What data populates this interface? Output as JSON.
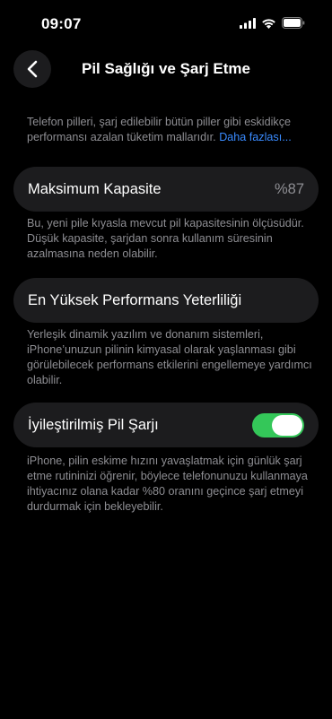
{
  "status_bar": {
    "time": "09:07"
  },
  "nav": {
    "title": "Pil Sağlığı ve Şarj Etme"
  },
  "intro": {
    "text": "Telefon pilleri, şarj edilebilir bütün piller gibi eskidikçe performansı azalan tüketim mallarıdır.",
    "link": "Daha fazlası..."
  },
  "max_capacity": {
    "label": "Maksimum Kapasite",
    "value": "%87",
    "footnote": "Bu, yeni pile kıyasla mevcut pil kapasitesinin ölçüsüdür. Düşük kapasite, şarjdan sonra kullanım süresinin azalmasına neden olabilir."
  },
  "peak_performance": {
    "label": "En Yüksek Performans Yeterliliği",
    "footnote": "Yerleşik dinamik yazılım ve donanım sistemleri, iPhone’unuzun pilinin kimyasal olarak yaşlanması gibi görülebilecek performans etkilerini engellemeye yardımcı olabilir."
  },
  "optimized_charging": {
    "label": "İyileştirilmiş Pil Şarjı",
    "enabled": true,
    "footnote": "iPhone, pilin eskime hızını yavaşlatmak için günlük şarj etme rutininizi öğrenir, böylece telefonunuzu kullanmaya ihtiyacınız olana kadar %80 oranını geçince şarj etmeyi durdurmak için bekleyebilir."
  },
  "colors": {
    "background": "#000000",
    "cell": "#1c1c1e",
    "secondary_text": "#8e8e93",
    "link": "#3a8bff",
    "toggle_on": "#34c759"
  },
  "icons": {
    "signal": "cellular-signal-icon",
    "wifi": "wifi-icon",
    "battery": "battery-icon",
    "back": "chevron-left-icon"
  }
}
